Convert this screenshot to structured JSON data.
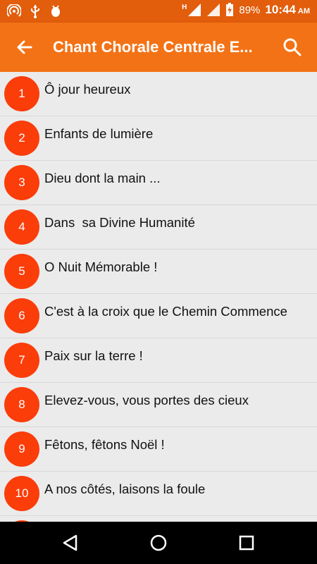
{
  "status_bar": {
    "icons": [
      "hotspot-icon",
      "usb-icon",
      "android-debug-icon"
    ],
    "network_type": "H",
    "battery_percent": "89%",
    "time": "10:44",
    "ampm": "AM"
  },
  "app_bar": {
    "title": "Chant Chorale Centrale E...",
    "back_icon": "arrow-back-icon",
    "search_icon": "search-icon"
  },
  "songs": [
    {
      "number": "1",
      "title": "Ô jour heureux"
    },
    {
      "number": "2",
      "title": "Enfants de lumière"
    },
    {
      "number": "3",
      "title": "Dieu dont la main ..."
    },
    {
      "number": "4",
      "title": "Dans  sa Divine Humanité"
    },
    {
      "number": "5",
      "title": "O Nuit Mémorable !"
    },
    {
      "number": "6",
      "title": "C'est à la croix que le Chemin Commence"
    },
    {
      "number": "7",
      "title": "Paix sur la terre !"
    },
    {
      "number": "8",
      "title": "Elevez-vous, vous portes des cieux"
    },
    {
      "number": "9",
      "title": "Fêtons, fêtons Noël !"
    },
    {
      "number": "10",
      "title": "A nos côtés, laisons la foule"
    }
  ],
  "nav_bar": {
    "icons": [
      "nav-back-icon",
      "nav-home-icon",
      "nav-recents-icon"
    ]
  },
  "colors": {
    "status_bar": "#e25d0c",
    "app_bar": "#f37215",
    "badge": "#fb3d0a",
    "list_bg": "#ebebeb"
  }
}
